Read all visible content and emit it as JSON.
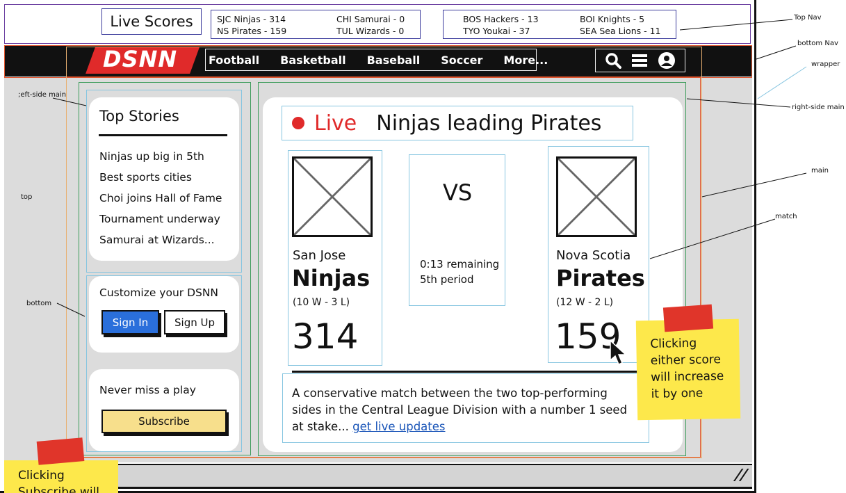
{
  "top_nav": {
    "title": "Live Scores",
    "scores_left": {
      "col1": [
        "SJC Ninjas - 314",
        "NS Pirates - 159"
      ],
      "col2": [
        "CHI Samurai - 0",
        "TUL Wizards - 0"
      ]
    },
    "scores_right": {
      "col1": [
        "BOS Hackers - 13",
        "TYO Youkai - 37"
      ],
      "col2": [
        "BOI Knights - 5",
        "SEA Sea Lions - 11"
      ]
    }
  },
  "bottom_nav": {
    "logo": "DSNN",
    "links": [
      "Football",
      "Basketball",
      "Baseball",
      "Soccer",
      "More..."
    ],
    "icons": [
      "search-icon",
      "menu-icon",
      "user-icon"
    ]
  },
  "top_stories": {
    "title": "Top Stories",
    "items": [
      "Ninjas up big in 5th",
      "Best sports cities",
      "Choi joins Hall of Fame",
      "Tournament underway",
      "Samurai at Wizards..."
    ]
  },
  "customize": {
    "title": "Customize your DSNN",
    "sign_in": "Sign In",
    "sign_up": "Sign Up"
  },
  "subscribe_card": {
    "title": "Never miss a play",
    "button": "Subscribe"
  },
  "match": {
    "live_label": "Live",
    "headline": "Ninjas leading Pirates",
    "vs": "VS",
    "status_line1": "0:13 remaining",
    "status_line2": "5th period",
    "home": {
      "city": "San Jose",
      "name": "Ninjas",
      "record": "(10 W - 3 L)",
      "score": "314"
    },
    "away": {
      "city": "Nova Scotia",
      "name": "Pirates",
      "record": "(12 W - 2 L)",
      "score": "159"
    },
    "description": "A conservative match between the two top-performing sides in the Central League Division with a number 1 seed at stake...",
    "link": "get live updates"
  },
  "sticky_notes": {
    "score_note": [
      "Clicking",
      "either score",
      "will increase",
      "it by one"
    ],
    "subscribe_note": [
      "Clicking",
      "Subscribe will"
    ]
  },
  "annotations": {
    "top_nav": "Top Nav",
    "bottom_nav": "bottom Nav",
    "wrapper": "wrapper",
    "left_side_main": ";eft-side main",
    "right_side_main": "right-side main",
    "main": "main",
    "top": "top",
    "match": "match",
    "bottom": "bottom"
  },
  "colors": {
    "accent_red": "#e02a2a",
    "nav_bg": "#111111",
    "link_blue": "#1a55b8",
    "sign_in_blue": "#2a6fdb",
    "subscribe_yellow": "#f7df8c",
    "sticky_yellow": "#fde84b"
  }
}
